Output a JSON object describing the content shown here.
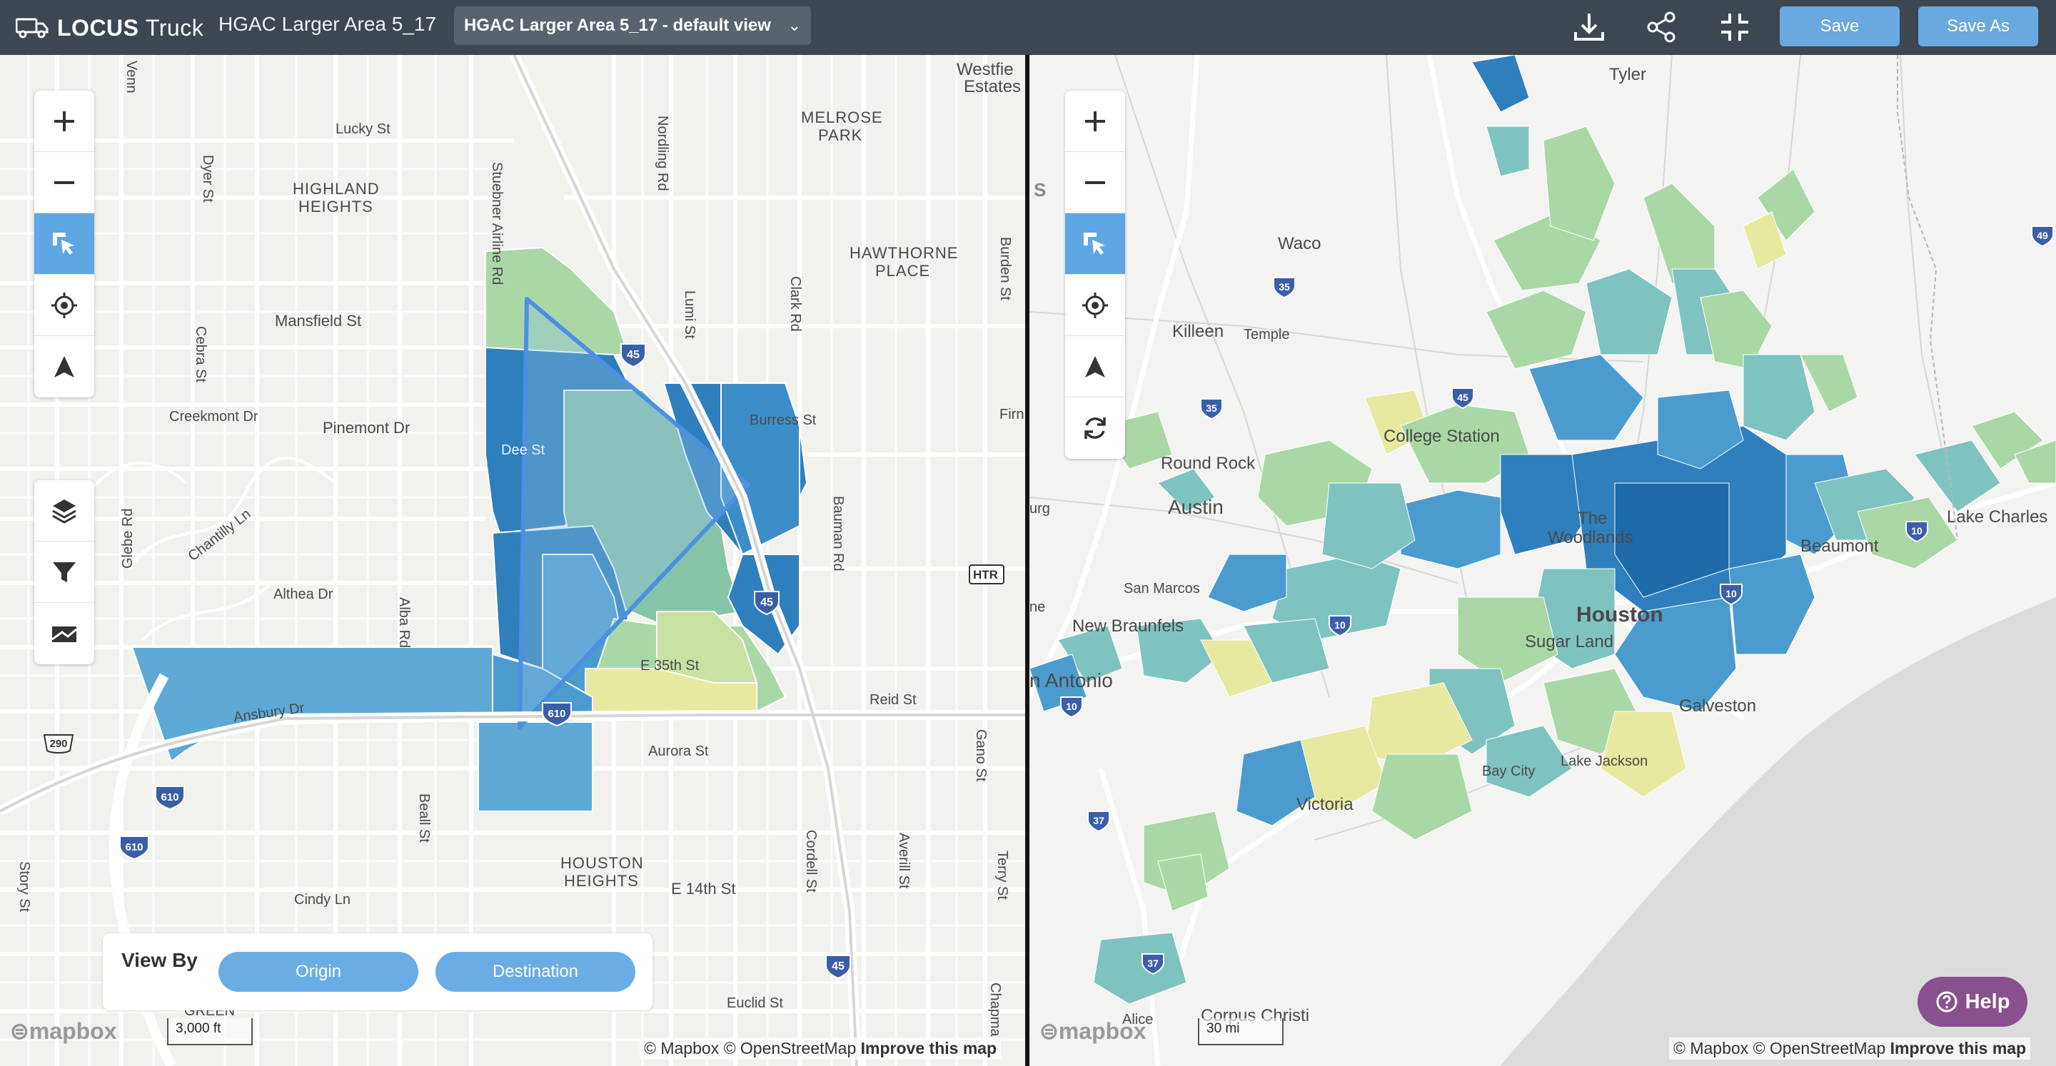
{
  "app": {
    "brand_bold": "LOCUS",
    "brand_light": "Truck",
    "project_title": "HGAC Larger Area 5_17"
  },
  "view_select": {
    "selected": "HGAC Larger Area 5_17 - default view"
  },
  "toolbar": {
    "save_label": "Save",
    "save_as_label": "Save As",
    "icons": [
      "download-icon",
      "share-icon",
      "collapse-icon"
    ]
  },
  "map_controls_left": [
    "zoom-in",
    "zoom-out",
    "select",
    "locate",
    "north",
    "layers",
    "filter",
    "map-style"
  ],
  "map_controls_right": [
    "zoom-in",
    "zoom-out",
    "select",
    "locate",
    "north",
    "refresh"
  ],
  "left_map": {
    "labels": {
      "lucky": "Lucky St",
      "highland": "HIGHLAND",
      "heights": "HEIGHTS",
      "mansfield": "Mansfield St",
      "creekmont": "Creekmont Dr",
      "pinemont": "Pinemont Dr",
      "chantilly": "Chantilly Ln",
      "althea": "Althea Dr",
      "ansbury": "Ansbury Dr",
      "glebe": "Glebe Rd",
      "cebra": "Cebra St",
      "dyer": "Dyer St",
      "alba": "Alba Rd",
      "stuebner": "Stuebner Airline Rd",
      "dee": "Dee St",
      "nordling": "Nordling Rd",
      "lumi": "Lumi St",
      "clark": "Clark Rd",
      "melrose": "MELROSE",
      "park": "PARK",
      "hawthorne": "HAWTHORNE",
      "place": "PLACE",
      "burden": "Burden St",
      "burress": "Burress St",
      "bauman": "Bauman Rd",
      "e35th": "E 35th St",
      "reid": "Reid St",
      "aurora": "Aurora St",
      "beall": "Beall St",
      "houston_h1": "HOUSTON",
      "houston_h2": "HEIGHTS",
      "e14th": "E 14th St",
      "cordell": "Cordell St",
      "averill": "Averill St",
      "terry": "Terry St",
      "gano": "Gano St",
      "euclid": "Euclid St",
      "cindy": "Cindy Ln",
      "story": "Story St",
      "westfield1": "Westfie",
      "westfield2": "Estates",
      "htr": "HTR",
      "firn": "Firn",
      "chapman": "Chapma",
      "green": "GREEN",
      "venn": "Venn"
    },
    "shields": [
      "45",
      "45",
      "45",
      "610",
      "610",
      "610",
      "290"
    ],
    "scale": "3,000 ft"
  },
  "right_map": {
    "labels": {
      "tyler": "Tyler",
      "waco": "Waco",
      "killeen": "Killeen",
      "temple": "Temple",
      "college_station": "College Station",
      "round_rock": "Round Rock",
      "austin": "Austin",
      "san_marcos": "San Marcos",
      "new_braunfels": "New Braunfels",
      "san_antonio": "n Antonio",
      "the": "The",
      "woodlands": "Woodlands",
      "houston": "Houston",
      "sugar_land": "Sugar Land",
      "galveston": "Galveston",
      "lake_jackson": "Lake Jackson",
      "bay_city": "Bay City",
      "victoria": "Victoria",
      "beaumont": "Beaumont",
      "lake_charles": "Lake Charles",
      "corpus": "Corpus Christi",
      "alice": "Alice",
      "s": "S",
      "urg": "urg",
      "ne": "ne"
    },
    "shields": [
      "35",
      "35",
      "45",
      "10",
      "10",
      "10",
      "10",
      "49",
      "37",
      "37"
    ],
    "scale": "30 mi"
  },
  "view_by": {
    "label": "View By",
    "origin": "Origin",
    "destination": "Destination"
  },
  "attribution": {
    "mapbox": "© Mapbox",
    "osm": "© OpenStreetMap",
    "improve": "Improve this map",
    "logo": "mapbox"
  },
  "help": {
    "label": "Help"
  },
  "colors": {
    "topbar": "#3d4752",
    "accent": "#5ea7e2",
    "help": "#8a4f8e",
    "dark_blue": "#2f7fbc",
    "mid_blue": "#4c9bcf",
    "teal": "#7fc3c0",
    "green": "#a9d8a6",
    "yellow": "#e7e9a0"
  }
}
